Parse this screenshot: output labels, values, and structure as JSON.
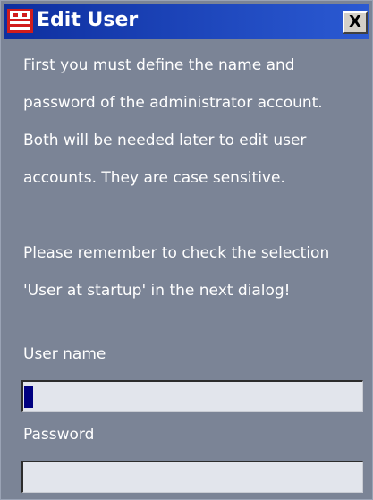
{
  "window": {
    "title": "Edit User",
    "close_label": "X"
  },
  "message": {
    "lines_1": [
      "First you must define the name and",
      "password of the administrator account.",
      "Both will be needed later to edit user",
      "accounts. They are case sensitive."
    ],
    "lines_2": [
      "Please remember to check the selection",
      "'User at startup' in the next dialog!"
    ]
  },
  "form": {
    "username_label": "User name",
    "username_value": "",
    "password_label": "Password",
    "password_value": ""
  },
  "colors": {
    "titlebar": "#1e3fa8",
    "background": "#7b8496",
    "field": "#e2e5ec",
    "caret": "#000080"
  },
  "icons": {
    "app": "app-logo-icon",
    "close": "close-icon"
  }
}
